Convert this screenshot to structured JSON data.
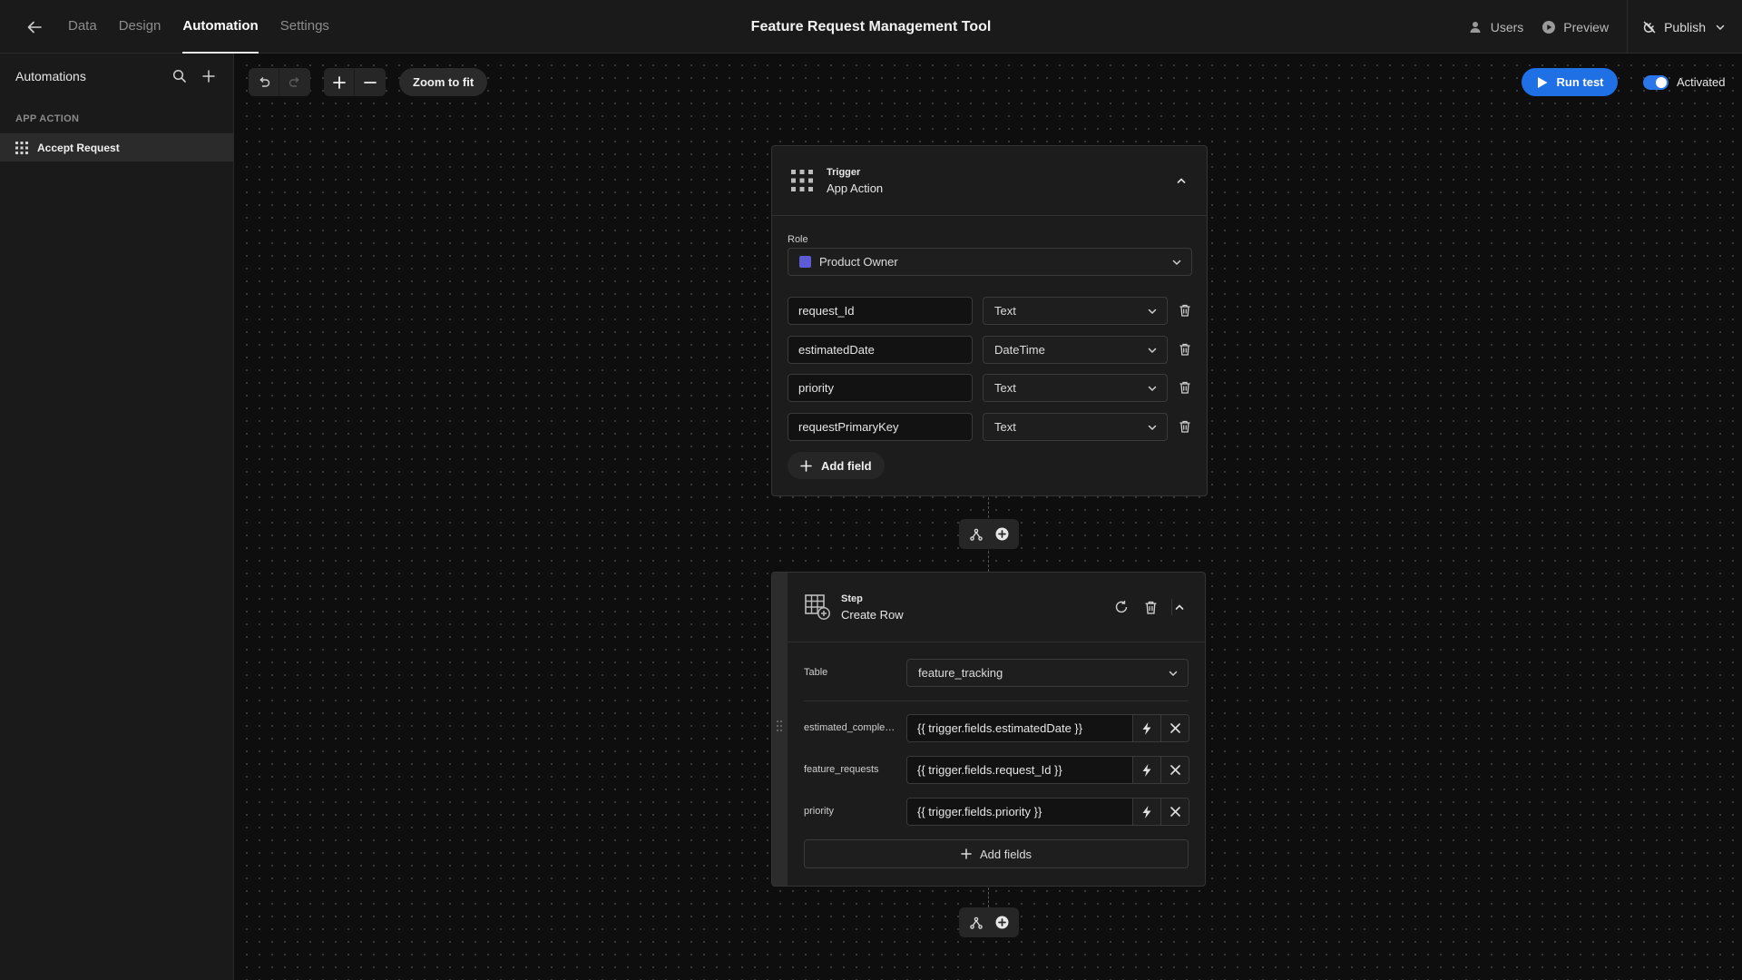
{
  "app": {
    "title": "Feature Request Management Tool",
    "tabs": [
      "Data",
      "Design",
      "Automation",
      "Settings"
    ],
    "active_tab": "Automation",
    "actions": {
      "users": "Users",
      "preview": "Preview",
      "publish": "Publish"
    }
  },
  "sidebar": {
    "title": "Automations",
    "section": "APP ACTION",
    "items": [
      {
        "label": "Accept Request",
        "selected": true
      }
    ]
  },
  "toolbar": {
    "zoom_to_fit": "Zoom to fit",
    "run_test": "Run test",
    "activated_label": "Activated",
    "activated": true
  },
  "trigger": {
    "kicker": "Trigger",
    "name": "App Action",
    "role_label": "Role",
    "role_value": "Product Owner",
    "role_color": "#5b5bd6",
    "fields": [
      {
        "name": "request_Id",
        "type": "Text"
      },
      {
        "name": "estimatedDate",
        "type": "DateTime"
      },
      {
        "name": "priority",
        "type": "Text"
      },
      {
        "name": "requestPrimaryKey",
        "type": "Text"
      }
    ],
    "add_field": "Add field"
  },
  "step": {
    "kicker": "Step",
    "name": "Create Row",
    "table_label": "Table",
    "table_value": "feature_tracking",
    "rows": [
      {
        "label": "estimated_comple…",
        "value": "{{ trigger.fields.estimatedDate }}"
      },
      {
        "label": "feature_requests",
        "value": "{{ trigger.fields.request_Id }}"
      },
      {
        "label": "priority",
        "value": "{{ trigger.fields.priority }}"
      }
    ],
    "add_fields": "Add fields"
  },
  "colors": {
    "accent": "#1f6fe5",
    "background": "#0e0e0e",
    "panel": "#1a1a1a"
  }
}
